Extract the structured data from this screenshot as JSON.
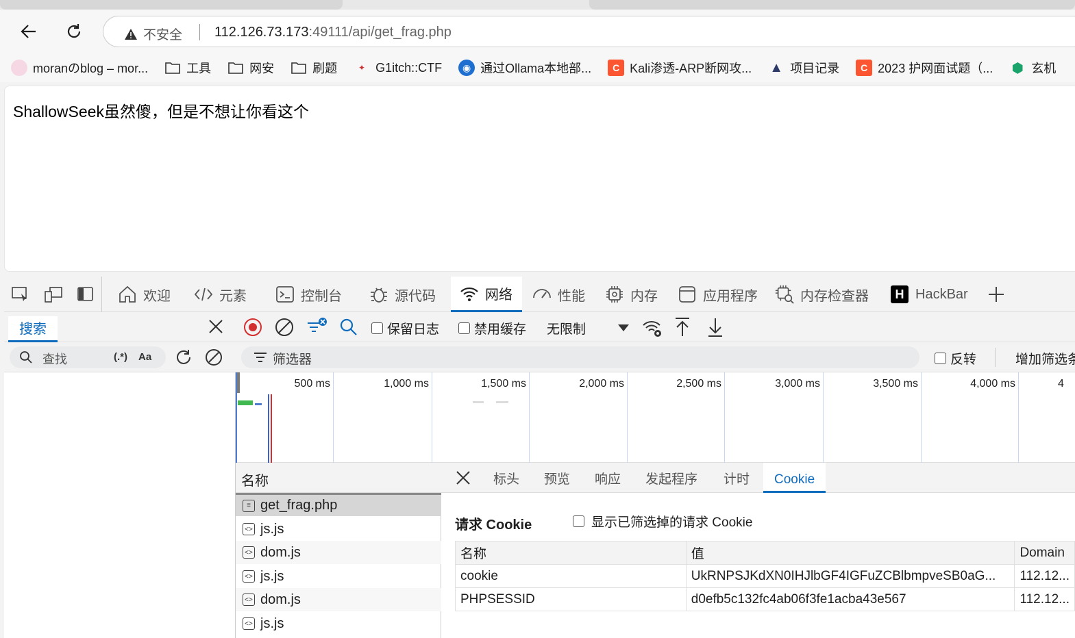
{
  "browser": {
    "address": {
      "security_label": "不安全",
      "url_host": "112.126.73.173",
      "url_rest": ":49111/api/get_frag.php"
    },
    "bookmarks": [
      {
        "label": "moranのblog – mor...",
        "icon": "avatar-icon"
      },
      {
        "label": "工具",
        "icon": "folder-icon"
      },
      {
        "label": "网安",
        "icon": "folder-icon"
      },
      {
        "label": "刷题",
        "icon": "folder-icon"
      },
      {
        "label": "G1itch::CTF",
        "icon": "site-icon"
      },
      {
        "label": "通过Ollama本地部...",
        "icon": "ollama-icon"
      },
      {
        "label": "Kali渗透-ARP断网攻...",
        "icon": "csdn-icon"
      },
      {
        "label": "项目记录",
        "icon": "xss-icon"
      },
      {
        "label": "2023 护网面试题（...",
        "icon": "csdn-icon"
      },
      {
        "label": "玄机",
        "icon": "shield-icon"
      }
    ]
  },
  "page": {
    "text": "ShallowSeek虽然傻，但是不想让你看这个"
  },
  "devtools": {
    "tabs": [
      {
        "label": "欢迎",
        "icon": "home-icon"
      },
      {
        "label": "元素",
        "icon": "code-icon"
      },
      {
        "label": "控制台",
        "icon": "console-icon"
      },
      {
        "label": "源代码",
        "icon": "bug-icon"
      },
      {
        "label": "网络",
        "icon": "wifi-icon"
      },
      {
        "label": "性能",
        "icon": "gauge-icon"
      },
      {
        "label": "内存",
        "icon": "chip-icon"
      },
      {
        "label": "应用程序",
        "icon": "app-icon"
      },
      {
        "label": "内存检查器",
        "icon": "memory-inspector-icon"
      },
      {
        "label": "HackBar",
        "icon": "hackbar-icon"
      }
    ],
    "search": {
      "tab_label": "搜索",
      "placeholder": "查找",
      "regex_label": "(.*)",
      "case_label": "Aa"
    },
    "network": {
      "preserve_log": "保留日志",
      "disable_cache": "禁用缓存",
      "throttle": "无限制",
      "filter_placeholder": "筛选器",
      "invert": "反转",
      "more_filters": "增加筛选条件",
      "timeline_labels": [
        "500 ms",
        "1,000 ms",
        "1,500 ms",
        "2,000 ms",
        "2,500 ms",
        "3,000 ms",
        "3,500 ms",
        "4,000 ms",
        "4"
      ],
      "list_header": "名称",
      "requests": [
        {
          "name": "get_frag.php",
          "type": "document"
        },
        {
          "name": "js.js",
          "type": "script"
        },
        {
          "name": "dom.js",
          "type": "script"
        },
        {
          "name": "js.js",
          "type": "script"
        },
        {
          "name": "dom.js",
          "type": "script"
        },
        {
          "name": "js.js",
          "type": "script"
        }
      ]
    },
    "detail": {
      "tabs": [
        "标头",
        "预览",
        "响应",
        "发起程序",
        "计时",
        "Cookie"
      ],
      "active_tab": "Cookie",
      "request_cookie_title": "请求 Cookie",
      "show_filtered": "显示已筛选掉的请求 Cookie",
      "columns": [
        "名称",
        "值",
        "Domain"
      ],
      "cookies": [
        {
          "name": "cookie",
          "value": "UkRNPSJKdXN0IHJlbGF4IGFuZCBlbmpveSB0aG...",
          "domain": "112.12..."
        },
        {
          "name": "PHPSESSID",
          "value": "d0efb5c132fc4ab06f3fe1acba43e567",
          "domain": "112.12..."
        }
      ]
    }
  }
}
